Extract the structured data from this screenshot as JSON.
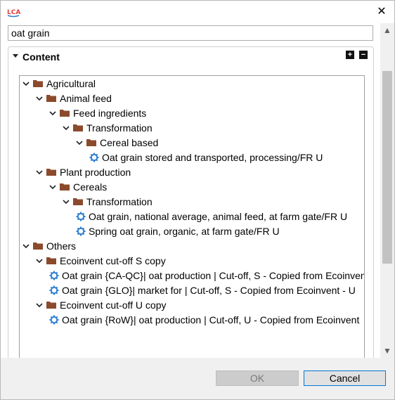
{
  "window": {
    "app_icon": "lca-logo-icon",
    "close_symbol": "✕"
  },
  "search": {
    "value": "oat grain"
  },
  "section": {
    "title": "Content",
    "expand_all": "+",
    "collapse_all": "−"
  },
  "tree": [
    {
      "level": 0,
      "expanded": true,
      "type": "folder",
      "label": "Agricultural"
    },
    {
      "level": 1,
      "expanded": true,
      "type": "folder",
      "label": "Animal feed"
    },
    {
      "level": 2,
      "expanded": true,
      "type": "folder",
      "label": "Feed ingredients"
    },
    {
      "level": 3,
      "expanded": true,
      "type": "folder",
      "label": "Transformation"
    },
    {
      "level": 4,
      "expanded": true,
      "type": "folder",
      "label": "Cereal based"
    },
    {
      "level": 5,
      "expanded": false,
      "type": "process",
      "label": "Oat grain stored and transported, processing/FR U"
    },
    {
      "level": 1,
      "expanded": true,
      "type": "folder",
      "label": "Plant production"
    },
    {
      "level": 2,
      "expanded": true,
      "type": "folder",
      "label": "Cereals"
    },
    {
      "level": 3,
      "expanded": true,
      "type": "folder",
      "label": "Transformation"
    },
    {
      "level": 4,
      "expanded": false,
      "type": "process",
      "label": "Oat grain, national average, animal feed, at farm gate/FR U"
    },
    {
      "level": 4,
      "expanded": false,
      "type": "process",
      "label": "Spring oat grain, organic, at farm gate/FR U"
    },
    {
      "level": 0,
      "expanded": true,
      "type": "folder",
      "label": "Others"
    },
    {
      "level": 1,
      "expanded": true,
      "type": "folder",
      "label": "Ecoinvent cut-off S copy"
    },
    {
      "level": 2,
      "expanded": false,
      "type": "process",
      "label": "Oat grain {CA-QC}| oat production | Cut-off, S - Copied from Ecoinvent"
    },
    {
      "level": 2,
      "expanded": false,
      "type": "process",
      "label": "Oat grain {GLO}| market for | Cut-off, S - Copied from Ecoinvent - U"
    },
    {
      "level": 1,
      "expanded": true,
      "type": "folder",
      "label": "Ecoinvent cut-off U copy"
    },
    {
      "level": 2,
      "expanded": false,
      "type": "process",
      "label": "Oat grain {RoW}| oat production | Cut-off, U - Copied from Ecoinvent"
    }
  ],
  "buttons": {
    "ok": "OK",
    "cancel": "Cancel"
  },
  "colors": {
    "folder": "#8b4a2c",
    "process_gear": "#2f7fd1",
    "focus_border": "#0078d7"
  }
}
